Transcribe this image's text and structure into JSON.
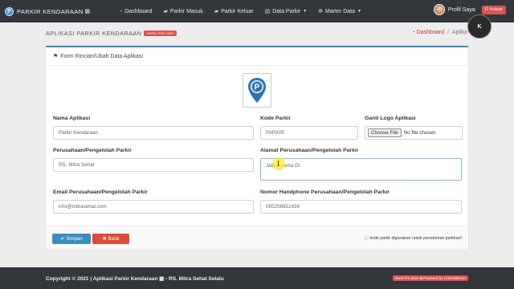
{
  "navbar": {
    "brand": "PARKIR KENDARAAN",
    "brand_icon": "logo-p-icon",
    "items": [
      {
        "label": "Dashboard",
        "icon": "gauge-icon"
      },
      {
        "label": "Parkir Masuk",
        "icon": "car-icon"
      },
      {
        "label": "Parkir Keluar",
        "icon": "car-exit-icon"
      },
      {
        "label": "Data Parkir",
        "icon": "table-icon",
        "dropdown": true
      },
      {
        "label": "Marter Data",
        "icon": "cogs-icon",
        "dropdown": true
      }
    ],
    "profile_label": "Profil Saya",
    "logout_label": "Keluar"
  },
  "header": {
    "title": "APLIKASI PARKIR KENDARAAN",
    "version_badge": "VERSI PRO 2021",
    "breadcrumb": [
      "Dashboard",
      "Aplika"
    ]
  },
  "card": {
    "title": "Form Rincian/Ubah Data Aplikasi",
    "fields": {
      "nama_aplikasi": {
        "label": "Nama Aplikasi",
        "value": "Parkir Kendaraan"
      },
      "kode_parkir": {
        "label": "Kode Parkir",
        "value": "PARKIR"
      },
      "ganti_logo": {
        "label": "Ganti Logo Aplikasi",
        "button": "Choose File",
        "status": "No file chosen"
      },
      "perusahaan": {
        "label": "Perusahaan/Pengelolah Parkir",
        "value": "RS. Mitra Sehat"
      },
      "alamat": {
        "label": "Alamat Perusahaan/Pengelolah Parkir",
        "value": "Jala  ersama DI"
      },
      "email": {
        "label": "Email Perusahaan/Pengelolah Parkir",
        "value": "info@mitrasehat.com"
      },
      "nomor_hp": {
        "label": "Nomor Handphone Perusahaan/Pengelolah Parkir",
        "value": "085256651656"
      }
    },
    "save_label": "Simpan",
    "cancel_label": "Batal",
    "footnote": "kode parkir digunakan untuk penomoran parkiran!"
  },
  "footer": {
    "copyright": "Copyright © 2021 | Aplikasi Parkir Kendaraan ▦ - RS. Mitra Sehat Selalu",
    "badge": "Versi Pro 2021 ■ Powered by LOKOMEDIA"
  },
  "colors": {
    "navbar": "#33373b",
    "primary": "#3c8dbc",
    "danger": "#dd4b39",
    "logo_blue": "#2e74b5"
  }
}
